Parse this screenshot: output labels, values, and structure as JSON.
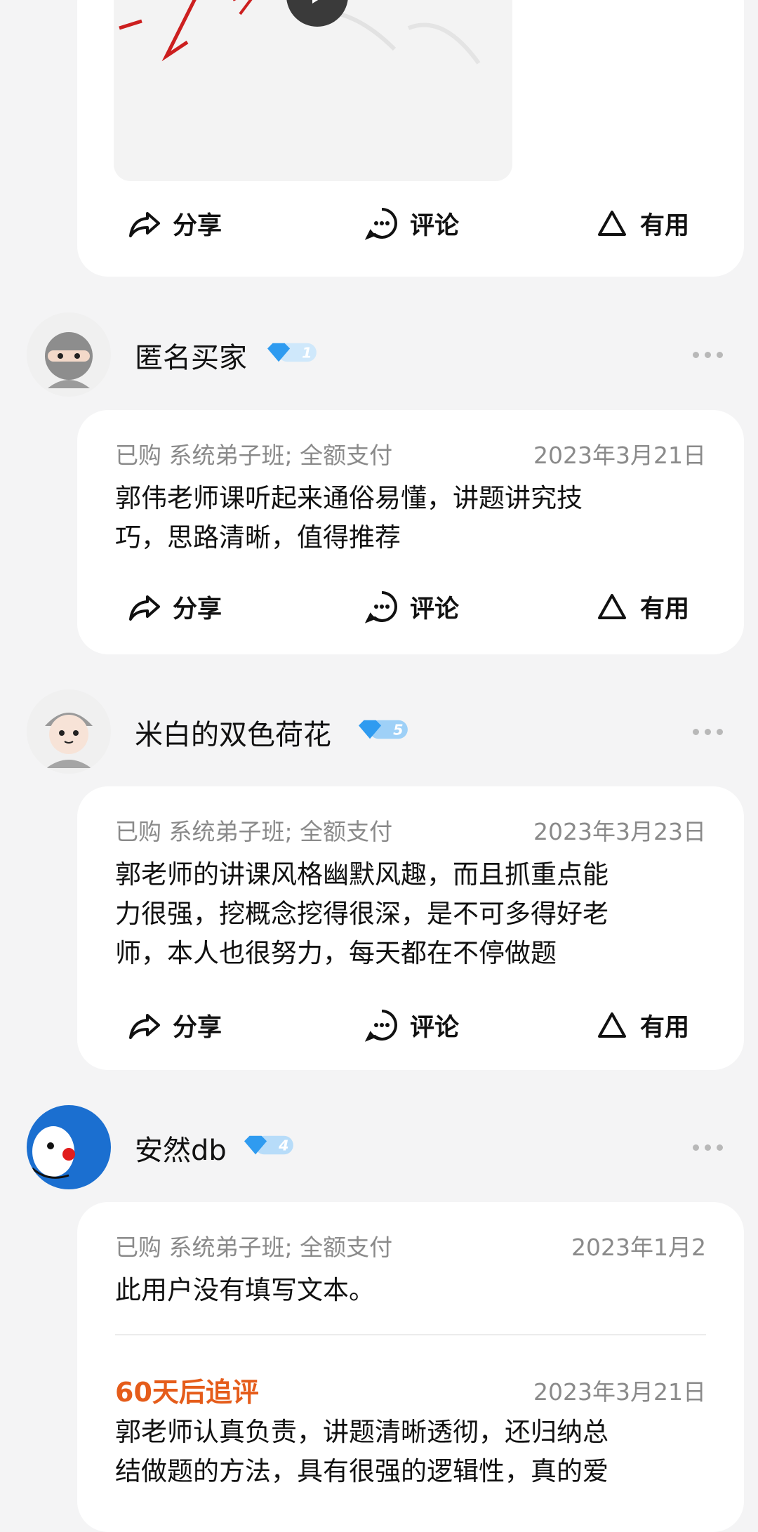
{
  "top_card": {
    "actions": {
      "share": "分享",
      "comment": "评论",
      "useful": "有用"
    }
  },
  "reviews": [
    {
      "username": "匿名买家",
      "level": "1",
      "purchased": "已购 系统弟子班; 全额支付",
      "date": "2023年3月21日",
      "text_lines": [
        "郭伟老师课听起来通俗易懂，讲题讲究技",
        "巧，思路清晰，值得推荐"
      ],
      "actions": {
        "share": "分享",
        "comment": "评论",
        "useful": "有用"
      }
    },
    {
      "username": "米白的双色荷花",
      "level": "5",
      "purchased": "已购 系统弟子班; 全额支付",
      "date": "2023年3月23日",
      "text_lines": [
        "郭老师的讲课风格幽默风趣，而且抓重点能",
        "力很强，挖概念挖得很深，是不可多得好老",
        "师，本人也很努力，每天都在不停做题"
      ],
      "actions": {
        "share": "分享",
        "comment": "评论",
        "useful": "有用"
      }
    },
    {
      "username": "安然db",
      "level": "4",
      "purchased": "已购 系统弟子班; 全额支付",
      "date": "2023年1月2",
      "text_lines": [
        "此用户没有填写文本。"
      ],
      "followup_label": "60天后追评",
      "followup_date": "2023年3月21日",
      "followup_lines": [
        "郭老师认真负责，讲题清晰透彻，还归纳总",
        "结做题的方法，具有很强的逻辑性，真的爱"
      ]
    }
  ]
}
